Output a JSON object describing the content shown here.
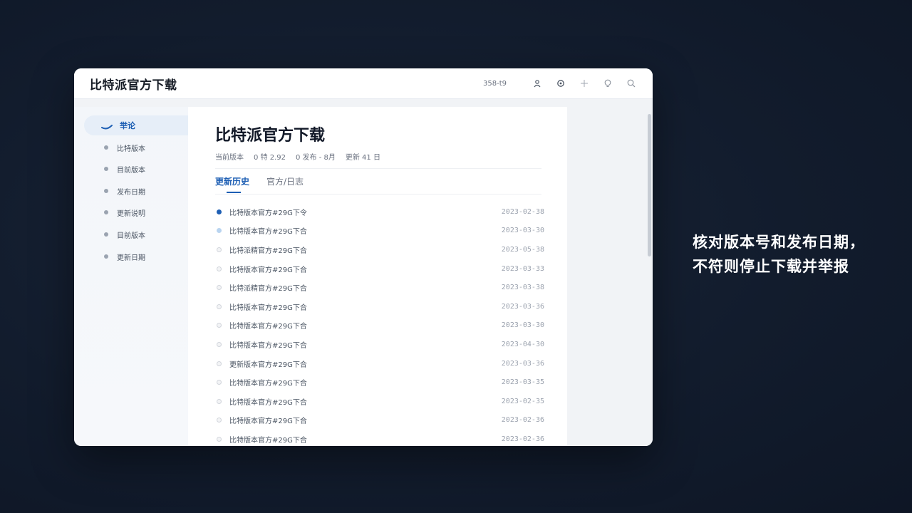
{
  "window": {
    "title": "比特派官方下载",
    "toolbar_text": "358-t9"
  },
  "sidebar": {
    "items": [
      {
        "label": "举论",
        "active": true
      },
      {
        "label": "比特版本"
      },
      {
        "label": "目前版本"
      },
      {
        "label": "发布日期"
      },
      {
        "label": "更新说明"
      },
      {
        "label": "目前版本"
      },
      {
        "label": "更新日期"
      }
    ]
  },
  "main": {
    "title": "比特派官方下载",
    "meta": [
      "当前版本",
      "0 特 2.92",
      "0 发布 - 8月",
      "更新 41 日"
    ],
    "tabs": [
      {
        "label": "更新历史",
        "active": true
      },
      {
        "label": "官方/日志"
      }
    ],
    "rows": [
      {
        "name": "比特版本官方#29G下令",
        "date": "2023-02-38"
      },
      {
        "name": "比特版本官方#29G下合",
        "date": "2023-03-30"
      },
      {
        "name": "比特派精官方#29G下合",
        "date": "2023-05-38"
      },
      {
        "name": "比特版本官方#29G下合",
        "date": "2023-03-33"
      },
      {
        "name": "比特派精官方#29G下合",
        "date": "2023-03-38"
      },
      {
        "name": "比特版本官方#29G下合",
        "date": "2023-03-36"
      },
      {
        "name": "比特版本官方#29G下合",
        "date": "2023-03-30"
      },
      {
        "name": "比特版本官方#29G下合",
        "date": "2023-04-30"
      },
      {
        "name": "更新版本官方#29G下合",
        "date": "2023-03-36"
      },
      {
        "name": "比特版本官方#29G下合",
        "date": "2023-03-35"
      },
      {
        "name": "比特版本官方#29G下合",
        "date": "2023-02-35"
      },
      {
        "name": "比特版本官方#29G下合",
        "date": "2023-02-36"
      },
      {
        "name": "比特版本官方#29G下合",
        "date": "2023-02-36"
      }
    ]
  },
  "caption": {
    "line1": "核对版本号和发布日期，",
    "line2": "不符则停止下载并举报"
  },
  "colors": {
    "accent": "#1e5fb4",
    "background": "#121c2d"
  },
  "icons": [
    "user-icon",
    "settings-icon",
    "plus-icon",
    "bulb-icon",
    "search-icon",
    "check-icon"
  ]
}
